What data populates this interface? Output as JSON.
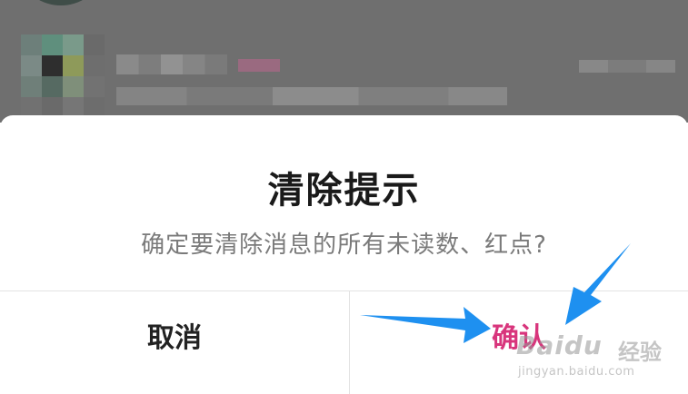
{
  "dialog": {
    "title": "清除提示",
    "message": "确定要清除消息的所有未读数、红点?",
    "cancel_label": "取消",
    "confirm_label": "确认"
  },
  "watermark": {
    "logo": "Baidu",
    "logo_suffix": "经验",
    "url": "jingyan.baidu.com"
  },
  "colors": {
    "confirm": "#d8357c",
    "title": "#1a1a1a",
    "message": "#7a7a7a",
    "arrow": "#1e90f0",
    "backdrop": "#6f6f6f"
  }
}
